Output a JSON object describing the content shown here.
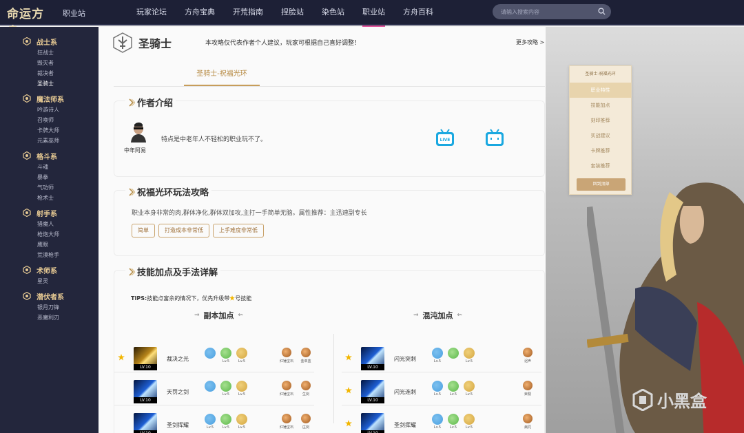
{
  "header": {
    "logo": "命运方舟",
    "logo_sub": "职业站",
    "nav": [
      "玩家论坛",
      "方舟宝典",
      "开荒指南",
      "捏脸站",
      "染色站",
      "职业站",
      "方舟百科"
    ],
    "active_nav": "职业站",
    "search_placeholder": "请输入搜索内容"
  },
  "sidebar": {
    "groups": [
      {
        "label": "战士系",
        "items": [
          "狂战士",
          "毁灭者",
          "裁决者",
          "圣骑士"
        ]
      },
      {
        "label": "魔法师系",
        "items": [
          "吟游诗人",
          "召唤师",
          "卡牌大师",
          "元素巫师"
        ]
      },
      {
        "label": "格斗系",
        "items": [
          "斗魂",
          "暴拳",
          "气功师",
          "枪术士"
        ]
      },
      {
        "label": "射手系",
        "items": [
          "猎魔人",
          "枪炮大师",
          "鹰眼",
          "荒漠枪手"
        ]
      },
      {
        "label": "术师系",
        "items": [
          "星灵"
        ]
      },
      {
        "label": "潜伏者系",
        "items": [
          "银月刀锋",
          "恶魔利刃"
        ]
      }
    ],
    "active_item": "圣骑士"
  },
  "main": {
    "class_name": "圣骑士",
    "note": "本攻略仅代表作者个人建议，玩家可根据自己喜好调整！",
    "more_link": "更多攻略 >",
    "build_tab": "圣骑士-祝福光环",
    "author_section": {
      "title": "作者介绍",
      "author_name": "中年阿易",
      "author_desc": "特点是中老年人不轻松的职业玩不了。"
    },
    "guide_section": {
      "title": "祝福光环玩法攻略",
      "desc": "职业本身非常的肉,群体净化,群体双加攻,主打一手简单无脑。属性推荐：主迅速副专长",
      "tags": [
        "简单",
        "打造成本非常低",
        "上手难度非常低"
      ]
    },
    "skills_section": {
      "title": "技能加点及手法详解",
      "tips_bold": "TIPS:",
      "tips": "技能点富余的情况下，优先升级带",
      "tips_end": "号技能",
      "col_left": "副本加点",
      "col_right": "混沌加点",
      "left": [
        {
          "star": true,
          "name": "裁决之光",
          "lv": "LV.10",
          "tri": [
            "",
            "Lv.5",
            "Lv.5"
          ],
          "gems": [
            "红锤宝石",
            "金单蓝"
          ],
          "color": "gold"
        },
        {
          "star": false,
          "name": "天罚之剑",
          "lv": "LV.10",
          "tri": [
            "",
            "Lv.5",
            "Lv.5"
          ],
          "gems": [
            "红锤宝石",
            "生剑"
          ],
          "color": "blue"
        },
        {
          "star": false,
          "name": "圣剑挥耀",
          "lv": "LV.10",
          "tri": [
            "Lv.5",
            "Lv.5",
            "Lv.5"
          ],
          "gems": [
            "红锤宝石",
            "庄剑"
          ],
          "color": "blue"
        }
      ],
      "right": [
        {
          "star": true,
          "name": "闪光突刺",
          "lv": "LV.10",
          "tri": [
            "Lv.5",
            "",
            "Lv.5"
          ],
          "gems": [
            "迟声"
          ],
          "color": "blue"
        },
        {
          "star": true,
          "name": "闪光连刺",
          "lv": "LV.10",
          "tri": [
            "Lv.5",
            "Lv.5",
            "Lv.5"
          ],
          "gems": [
            "束裂"
          ],
          "color": "blue"
        },
        {
          "star": true,
          "name": "圣剑挥耀",
          "lv": "LV.10",
          "tri": [
            "Lv.5",
            "Lv.5",
            "Lv.5"
          ],
          "gems": [
            "病咒"
          ],
          "color": "blue"
        }
      ]
    }
  },
  "float_nav": {
    "title": "圣骑士-祝福光环",
    "items": [
      "职业特性",
      "技能加点",
      "刻印推荐",
      "实战建议",
      "卡牌推荐",
      "套装推荐"
    ],
    "active": "职业特性",
    "back_top": "回到顶部"
  },
  "watermark": "小黑盒",
  "colors": {
    "accent": "#e0559b",
    "gold": "#c79d5a",
    "topbar": "#1d2036",
    "sidebar": "#23263c"
  }
}
